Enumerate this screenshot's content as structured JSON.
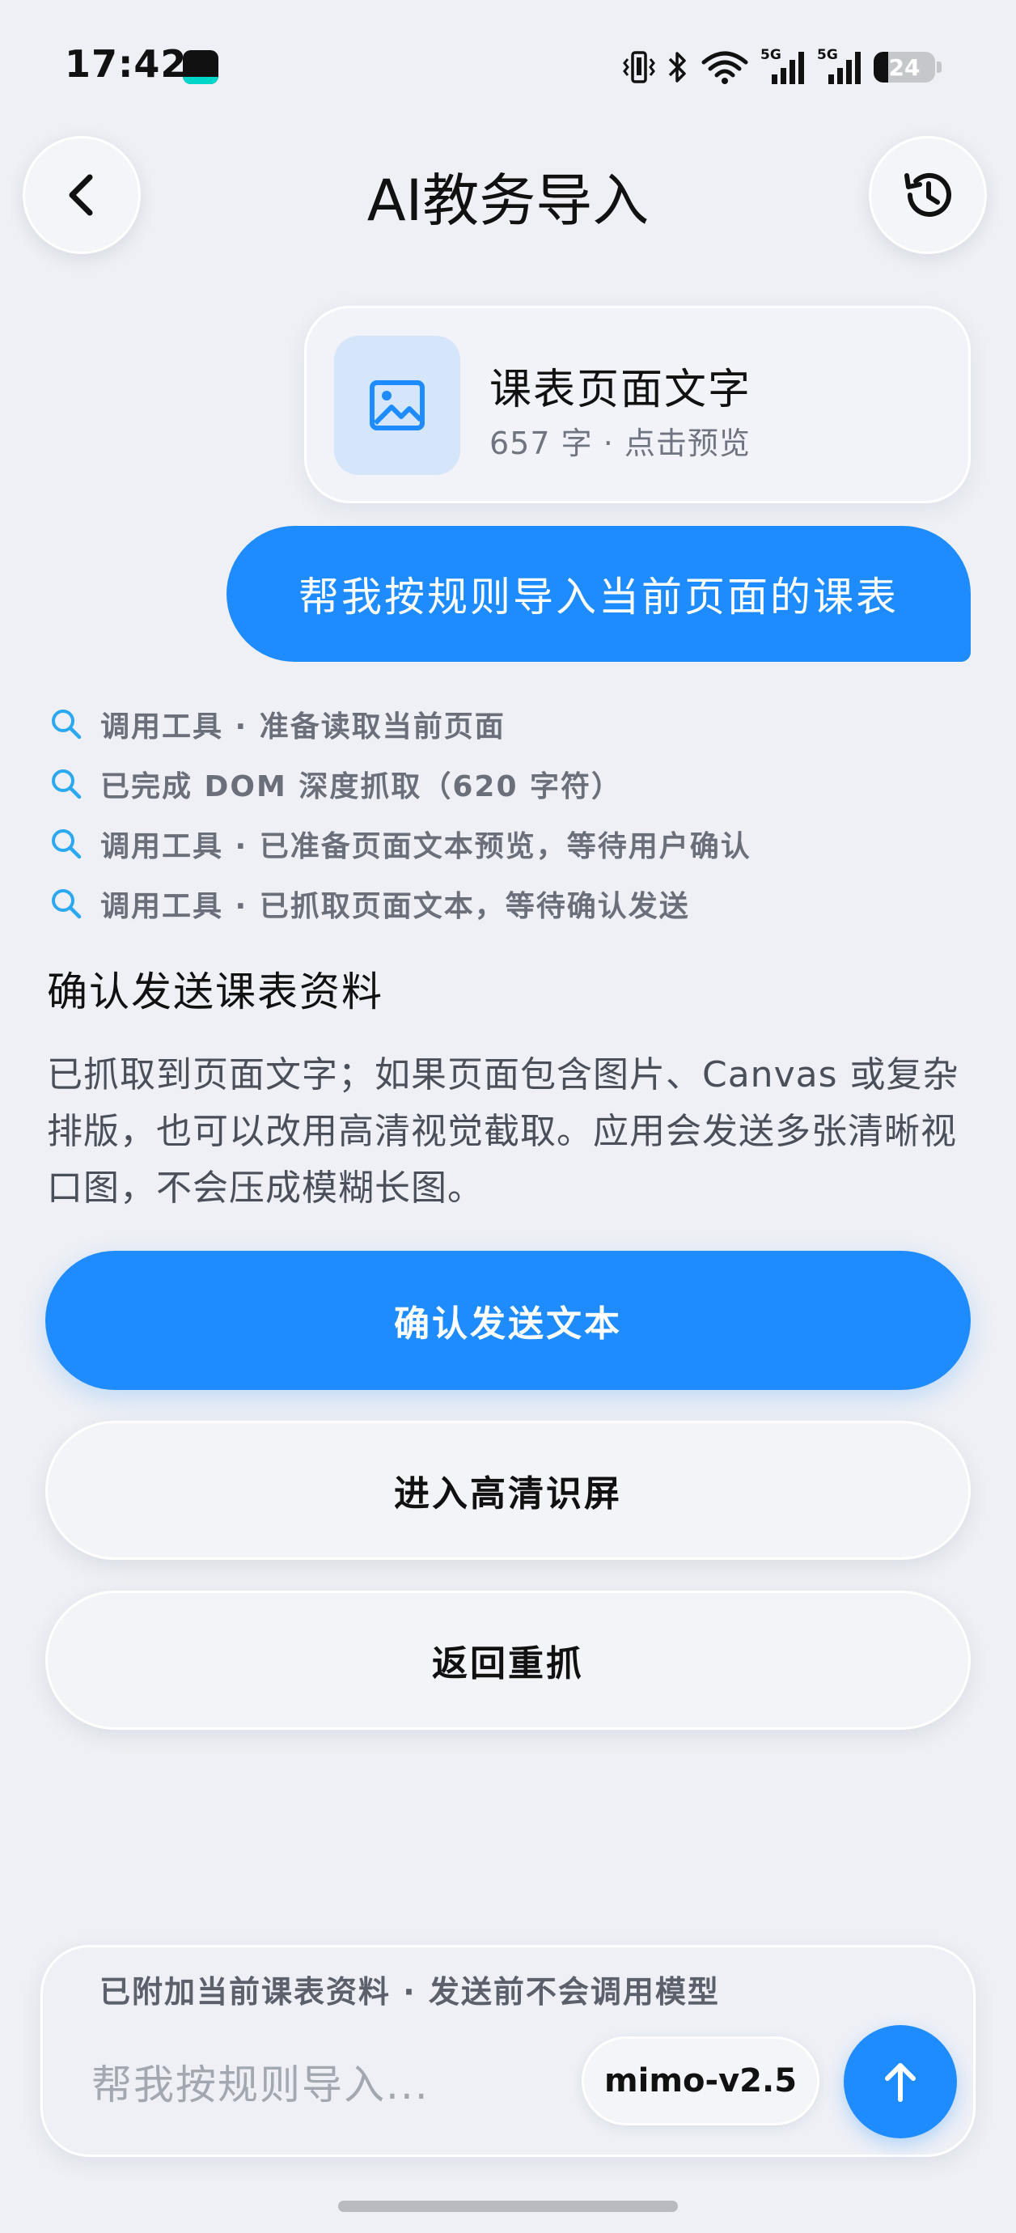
{
  "status_bar": {
    "time": "17:42",
    "network_label": "5G",
    "battery_level": "24",
    "icons": [
      "app-icon",
      "vibrate-icon",
      "bluetooth-icon",
      "wifi-icon",
      "signal-icon",
      "battery-icon"
    ]
  },
  "header": {
    "title": "AI教务导入",
    "back_icon": "chevron-left-icon",
    "history_icon": "history-icon"
  },
  "attachment": {
    "icon": "image-icon",
    "title": "课表页面文字",
    "meta": "657 字 · 点击预览"
  },
  "user_message": "帮我按规则导入当前页面的课表",
  "tool_log": [
    "调用工具 · 准备读取当前页面",
    "已完成 DOM 深度抓取（620 字符）",
    "调用工具 · 已准备页面文本预览，等待用户确认",
    "调用工具 · 已抓取页面文本，等待确认发送"
  ],
  "confirm": {
    "title": "确认发送课表资料",
    "description": "已抓取到页面文字；如果页面包含图片、Canvas 或复杂排版，也可以改用高清视觉截取。应用会发送多张清晰视口图，不会压成模糊长图。",
    "primary_label": "确认发送文本",
    "hd_label": "进入高清识屏",
    "retry_label": "返回重抓"
  },
  "composer": {
    "note": "已附加当前课表资料 · 发送前不会调用模型",
    "placeholder": "帮我按规则导入...",
    "model": "mimo-v2.5",
    "send_icon": "arrow-up-icon"
  },
  "colors": {
    "accent": "#1e8cff",
    "background": "#eef0f5",
    "muted_text": "#6a6f7a"
  }
}
